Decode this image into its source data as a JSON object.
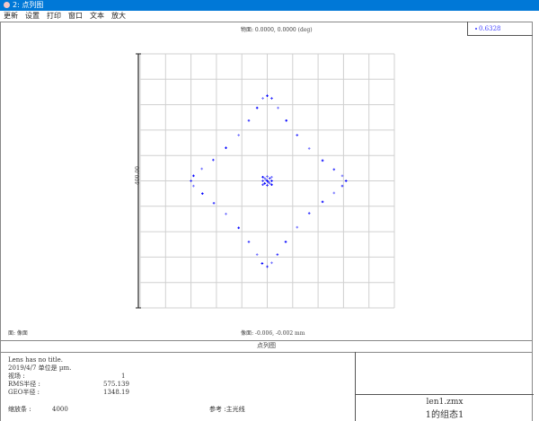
{
  "window": {
    "title": "2: 点列图"
  },
  "menu": [
    "更新",
    "设置",
    "打印",
    "窗口",
    "文本",
    "放大"
  ],
  "plot": {
    "field_label": "物面: 0.0000, 0.0000 (deg)",
    "legend_value": "0.6328",
    "scale_label": "400.00",
    "surface_label": "面: 像面",
    "image_label": "像面: -0.006, -0.002 mm",
    "caption": "点列图"
  },
  "info": {
    "line1": "Lens has no title.",
    "line2": "2019/4/7  单位是 µm.",
    "field_label": "视场     :",
    "field_value": "1",
    "rms_label": "RMS半径 :",
    "rms_value": "575.139",
    "geo_label": "GEO半径 :",
    "geo_value": "1348.19",
    "scale_label": "缩放条  :",
    "scale_value": "4000",
    "reference": "参考  :主光线"
  },
  "titlebox": {
    "file": "len1.zmx",
    "config": "1的组态1"
  },
  "colors": {
    "points": "#0000ff",
    "grid": "#d0d0d0"
  },
  "chart_data": {
    "type": "scatter",
    "xlabel": "",
    "ylabel": "400.00",
    "units": "µm",
    "xlim": [
      -200,
      200
    ],
    "ylim": [
      -200,
      200
    ],
    "grid": true,
    "series": [
      {
        "name": "0.6328",
        "points": [
          [
            0,
            134
          ],
          [
            -7,
            130
          ],
          [
            7,
            130
          ],
          [
            -16,
            115
          ],
          [
            17,
            115
          ],
          [
            -29,
            95
          ],
          [
            30,
            95
          ],
          [
            -45,
            72
          ],
          [
            47,
            72
          ],
          [
            -65,
            52
          ],
          [
            66,
            51
          ],
          [
            -85,
            33
          ],
          [
            87,
            32
          ],
          [
            -103,
            19
          ],
          [
            105,
            18
          ],
          [
            -116,
            8
          ],
          [
            118,
            8
          ],
          [
            -120,
            0
          ],
          [
            124,
            0
          ],
          [
            -116,
            -8
          ],
          [
            118,
            -8
          ],
          [
            -102,
            -20
          ],
          [
            105,
            -19
          ],
          [
            -84,
            -35
          ],
          [
            87,
            -33
          ],
          [
            -65,
            -52
          ],
          [
            66,
            -51
          ],
          [
            -45,
            -74
          ],
          [
            47,
            -73
          ],
          [
            -29,
            -96
          ],
          [
            29,
            -96
          ],
          [
            -16,
            -116
          ],
          [
            16,
            -116
          ],
          [
            -8,
            -130
          ],
          [
            7,
            -129
          ],
          [
            0,
            -135
          ],
          [
            0,
            0
          ],
          [
            -4,
            4
          ],
          [
            4,
            4
          ],
          [
            -4,
            -4
          ],
          [
            4,
            -4
          ],
          [
            -7,
            0
          ],
          [
            7,
            0
          ],
          [
            0,
            7
          ],
          [
            0,
            -7
          ],
          [
            -7,
            6
          ],
          [
            7,
            6
          ],
          [
            -7,
            -6
          ],
          [
            7,
            -6
          ],
          [
            -2,
            2
          ],
          [
            2,
            -2
          ]
        ]
      }
    ]
  }
}
